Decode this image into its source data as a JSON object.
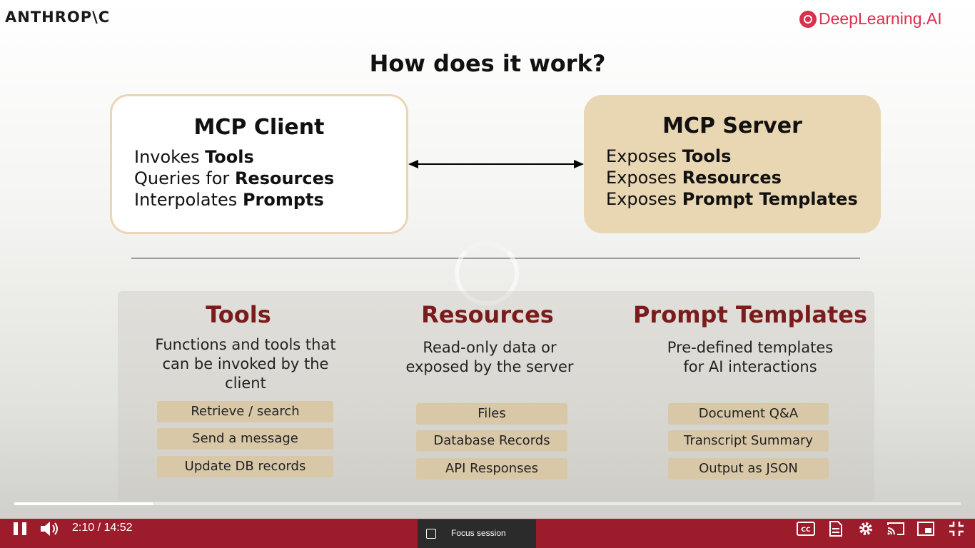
{
  "branding": {
    "left_logo": "ANTHROP\\C",
    "right_logo": "DeepLearning.AI"
  },
  "slide": {
    "title": "How does it work?",
    "client": {
      "title": "MCP Client",
      "lines": [
        {
          "prefix": "Invokes ",
          "bold": "Tools"
        },
        {
          "prefix": "Queries for ",
          "bold": "Resources"
        },
        {
          "prefix": "Interpolates ",
          "bold": "Prompts"
        }
      ]
    },
    "server": {
      "title": "MCP Server",
      "lines": [
        {
          "prefix": "Exposes ",
          "bold": "Tools"
        },
        {
          "prefix": "Exposes ",
          "bold": "Resources"
        },
        {
          "prefix": "Exposes ",
          "bold": "Prompt Templates"
        }
      ]
    },
    "columns": [
      {
        "title": "Tools",
        "desc": [
          "Functions and tools that",
          "can be invoked by the",
          "client"
        ],
        "items": [
          "Retrieve / search",
          "Send a message",
          "Update DB records"
        ]
      },
      {
        "title": "Resources",
        "desc": [
          "Read-only data or",
          "exposed by the server"
        ],
        "items": [
          "Files",
          "Database Records",
          "API Responses"
        ]
      },
      {
        "title": "Prompt Templates",
        "desc": [
          "Pre-defined templates",
          "for AI interactions"
        ],
        "items": [
          "Document Q&A",
          "Transcript Summary",
          "Output as JSON"
        ]
      }
    ]
  },
  "player": {
    "time": "2:10 / 14:52",
    "progress_fraction": 0.146,
    "focus_session_label": "Focus session",
    "accent_color": "#9c1c2c"
  }
}
